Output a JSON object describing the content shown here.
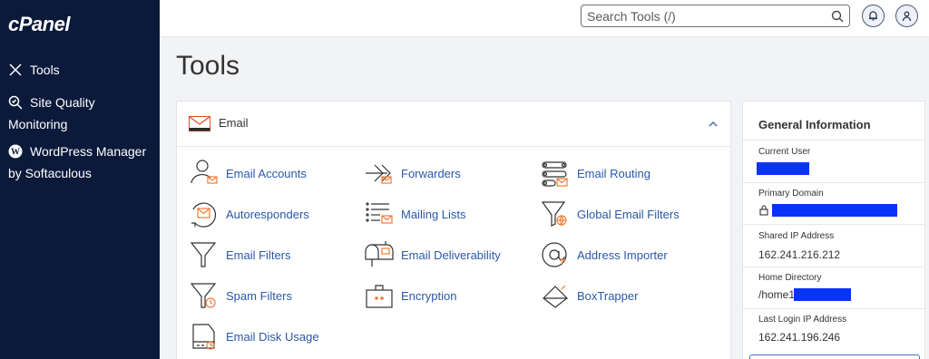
{
  "sidebar": {
    "logo": "cPanel",
    "items": [
      {
        "label": "Tools",
        "icon": "tools-icon"
      },
      {
        "label": "Site Quality Monitoring",
        "icon": "search-magnifier-icon"
      },
      {
        "label": "WordPress Manager by Softaculous",
        "icon": "wordpress-icon"
      }
    ]
  },
  "header": {
    "search_placeholder": "Search Tools (/)",
    "icons": [
      "search-icon",
      "bell-icon",
      "user-icon"
    ]
  },
  "page_title": "Tools",
  "email_section": {
    "title": "Email",
    "tools": [
      {
        "label": "Email Accounts",
        "icon": "email-accounts-icon"
      },
      {
        "label": "Forwarders",
        "icon": "forwarders-icon"
      },
      {
        "label": "Email Routing",
        "icon": "email-routing-icon"
      },
      {
        "label": "Autoresponders",
        "icon": "autoresponders-icon"
      },
      {
        "label": "Mailing Lists",
        "icon": "mailing-lists-icon"
      },
      {
        "label": "Global Email Filters",
        "icon": "global-email-filters-icon"
      },
      {
        "label": "Email Filters",
        "icon": "email-filters-icon"
      },
      {
        "label": "Email Deliverability",
        "icon": "email-deliverability-icon"
      },
      {
        "label": "Address Importer",
        "icon": "address-importer-icon"
      },
      {
        "label": "Spam Filters",
        "icon": "spam-filters-icon"
      },
      {
        "label": "Encryption",
        "icon": "encryption-icon"
      },
      {
        "label": "BoxTrapper",
        "icon": "boxtrapper-icon"
      },
      {
        "label": "Email Disk Usage",
        "icon": "email-disk-usage-icon"
      }
    ]
  },
  "general_info": {
    "title": "General Information",
    "current_user_label": "Current User",
    "primary_domain_label": "Primary Domain",
    "shared_ip_label": "Shared IP Address",
    "shared_ip_value": "162.241.216.212",
    "home_directory_label": "Home Directory",
    "home_directory_value": "/home1",
    "last_login_label": "Last Login IP Address",
    "last_login_value": "162.241.196.246"
  },
  "colors": {
    "sidebar_bg": "#0b1a3b",
    "link_blue": "#2a58a8",
    "accent_orange": "#f07b3a",
    "redaction_blue": "#0a34f5"
  }
}
